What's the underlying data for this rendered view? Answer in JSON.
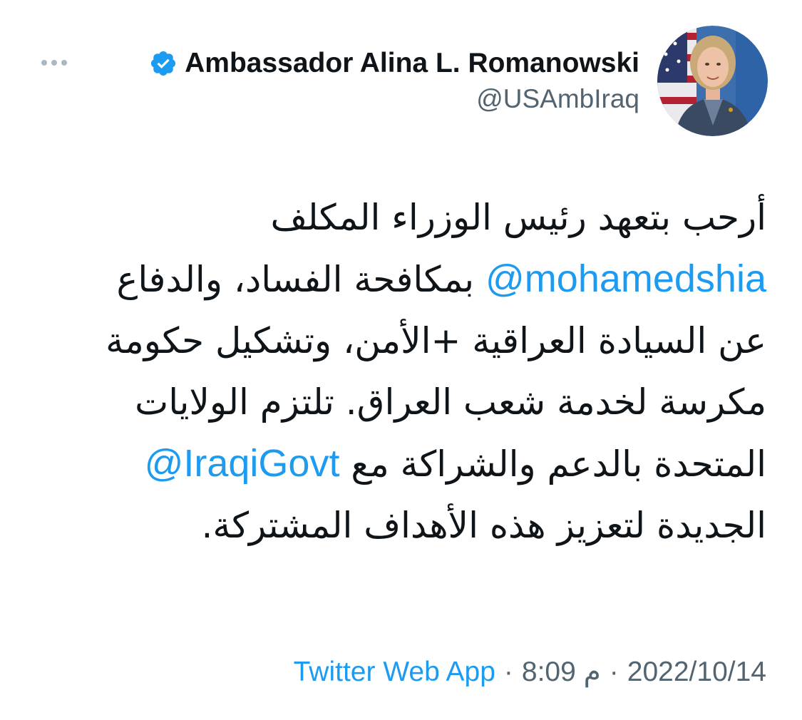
{
  "author": {
    "display_name": "Ambassador Alina L. Romanowski",
    "handle": "@USAmbIraq",
    "verified": true,
    "verified_color": "#1d9bf0"
  },
  "tweet": {
    "text_part1": "أرحب بتعهد رئيس الوزراء المكلف",
    "mention1": "@mohamedshia",
    "text_part2": "بمكافحة الفساد، والدفاع عن السيادة العراقية +الأمن، وتشكيل حكومة مكرسة لخدمة شعب العراق. تلتزم الولايات المتحدة بالدعم والشراكة مع",
    "mention2": "@IraqiGovt",
    "text_part3": "الجديدة لتعزيز هذه الأهداف المشتركة."
  },
  "meta": {
    "date": "2022/10/14",
    "separator1": "·",
    "time": "8:09 م",
    "separator2": "·",
    "source": "Twitter Web App"
  },
  "icons": {
    "more": "more-dots-icon",
    "verified": "verified-badge-icon"
  },
  "colors": {
    "link": "#1d9bf0",
    "secondary_text": "#536471",
    "primary_text": "#0f1419"
  }
}
